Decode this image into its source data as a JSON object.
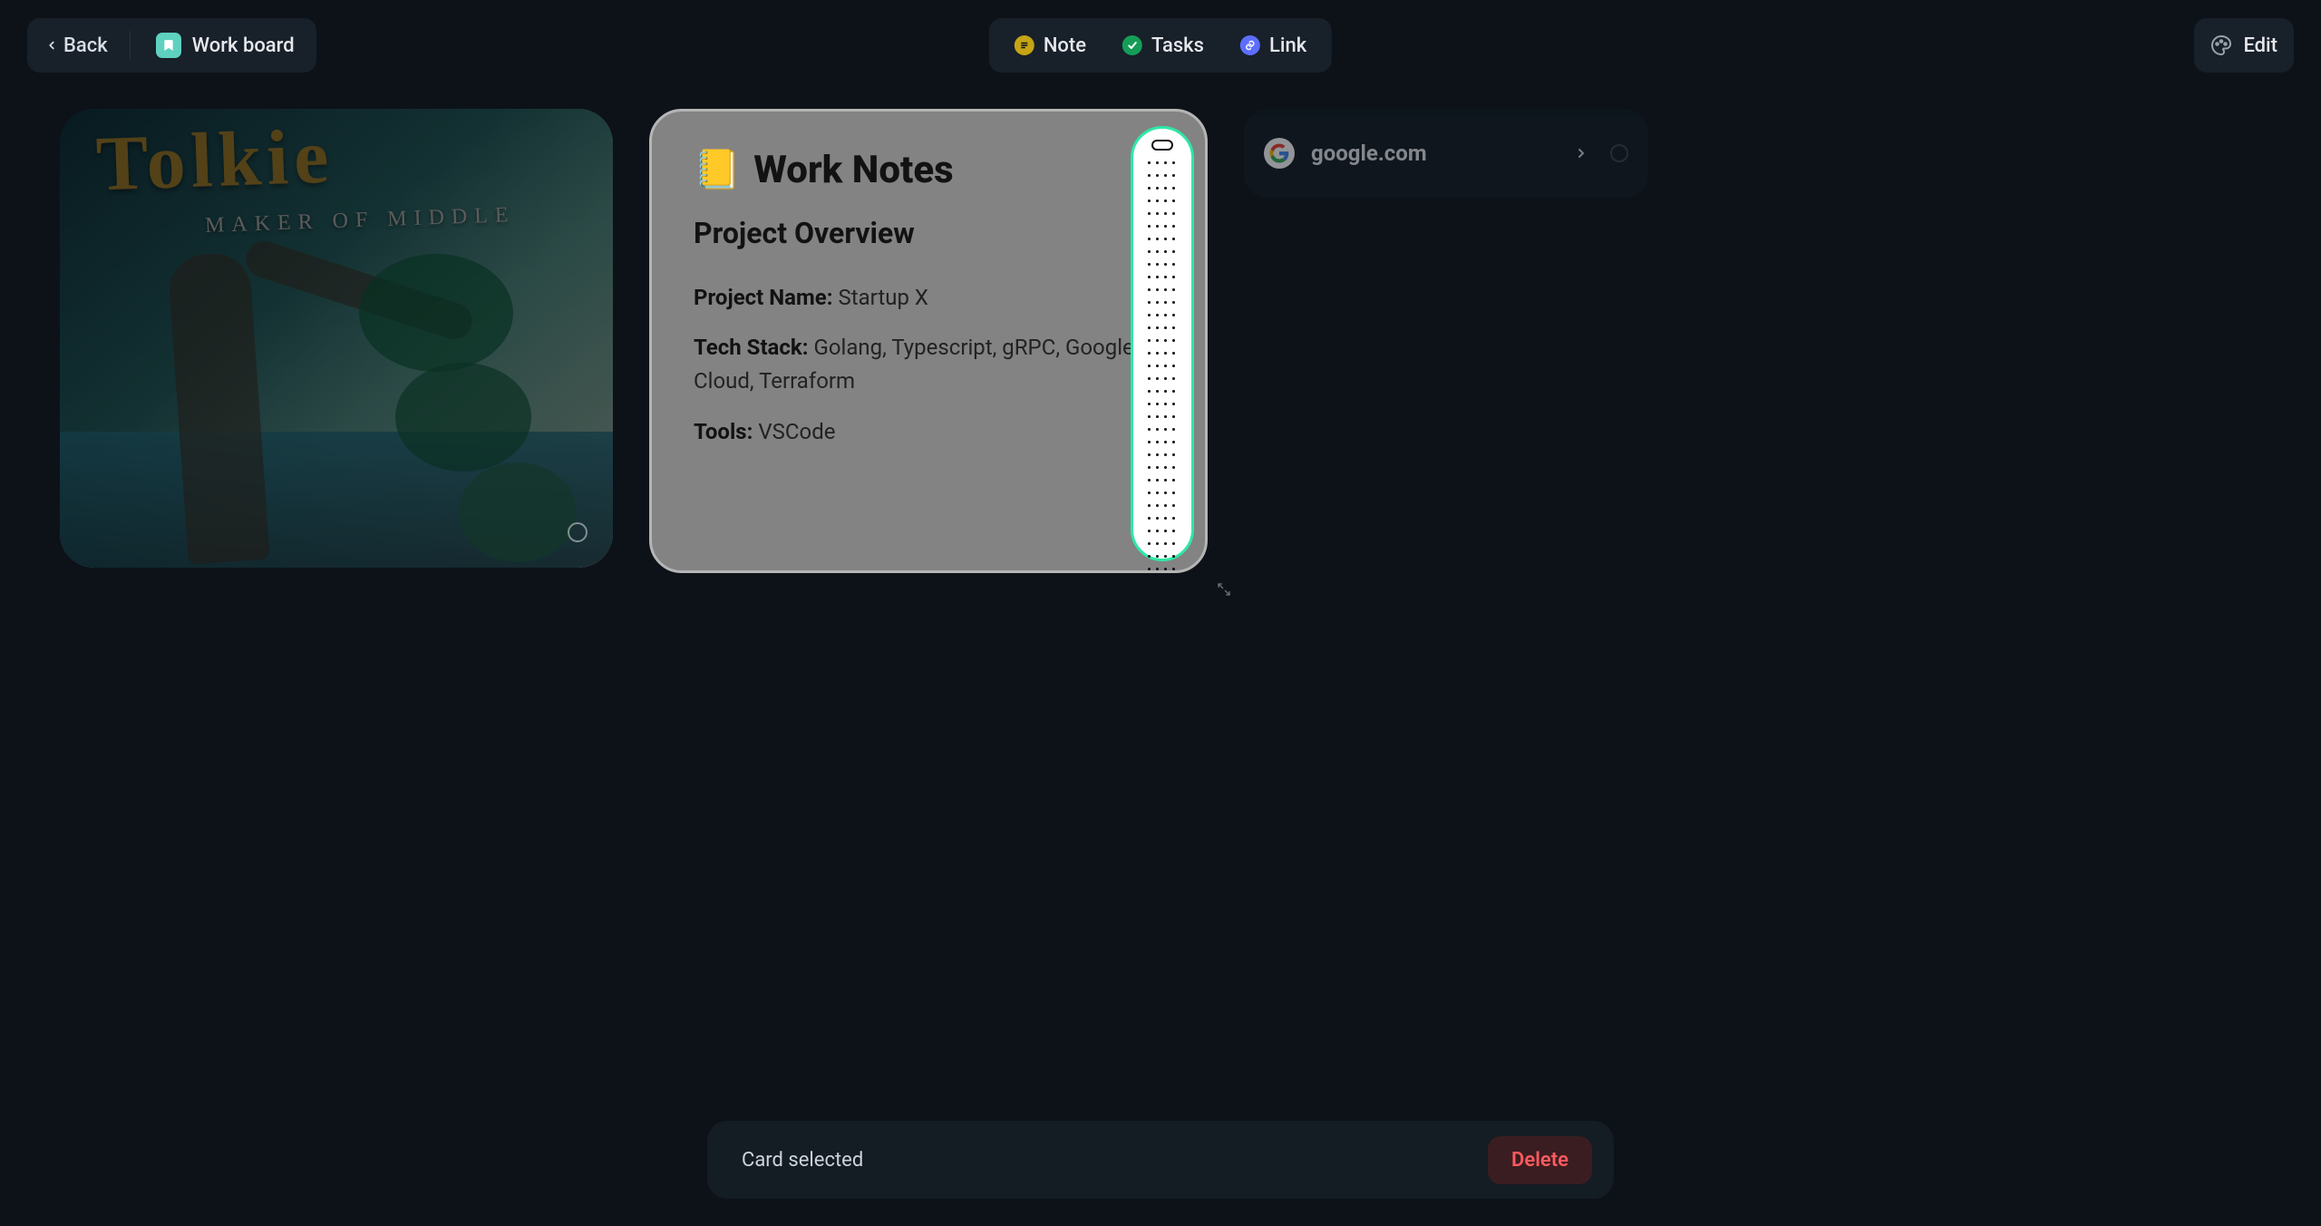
{
  "topbar": {
    "back_label": "Back",
    "board_name": "Work board",
    "tabs": {
      "note": "Note",
      "tasks": "Tasks",
      "link": "Link"
    },
    "edit_label": "Edit"
  },
  "image_card": {
    "title": "Tolkie",
    "subtitle": "MAKER  OF  MIDDLE"
  },
  "note_card": {
    "emoji": "📒",
    "title": "Work Notes",
    "section": "Project Overview",
    "labels": {
      "project_name": "Project Name:",
      "tech_stack": "Tech Stack:",
      "tools": "Tools:"
    },
    "values": {
      "project_name": "Startup X",
      "tech_stack": "Golang, Typescript, gRPC, Google Cloud, Terraform",
      "tools": "VSCode"
    }
  },
  "link_card": {
    "url": "google.com"
  },
  "selection_bar": {
    "message": "Card selected",
    "delete_label": "Delete"
  }
}
